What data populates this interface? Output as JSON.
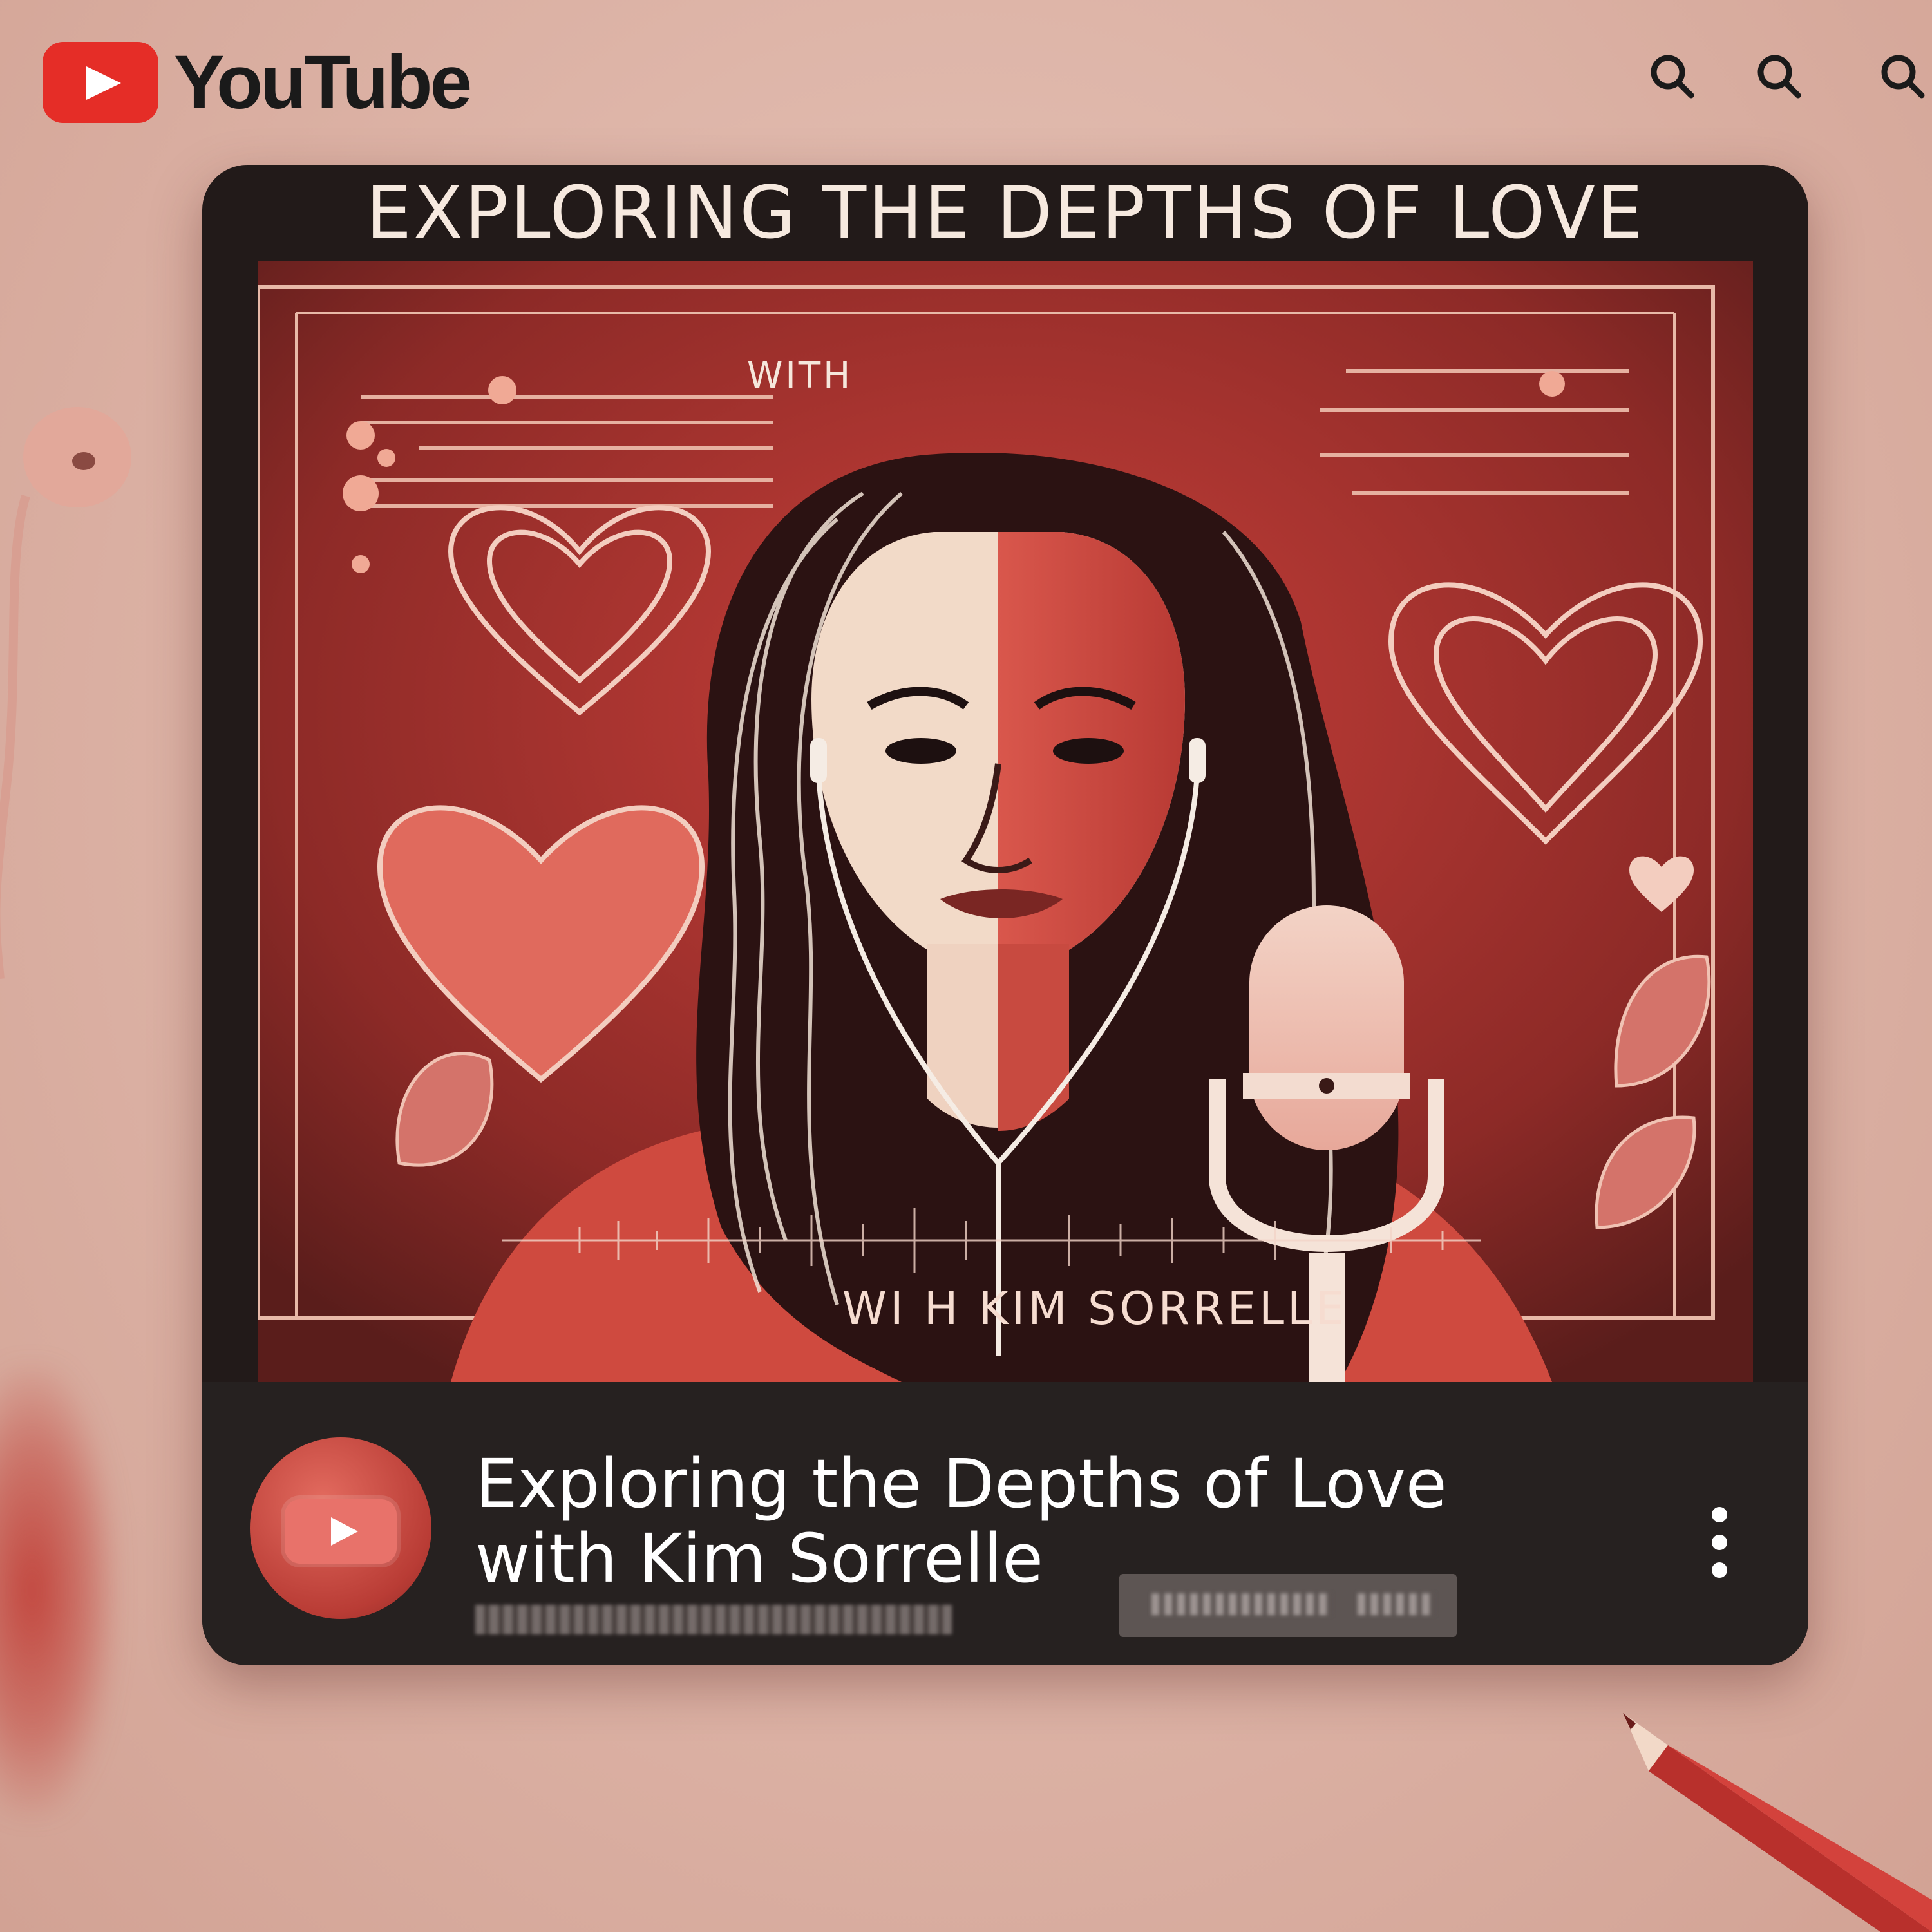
{
  "header": {
    "logo_text": "YouTube",
    "search_icons": [
      "search-icon",
      "search-icon",
      "search-icon"
    ]
  },
  "card": {
    "banner_title": "EXPLORING THE DEPTHS OF LOVE",
    "art_with_label": "WITH",
    "art_host_label": "WI H KIM SORRELLE"
  },
  "video": {
    "title_line1": "Exploring the Depths of Love",
    "title_line2": "with Kim Sorrelle",
    "menu_icon": "more-vert-icon"
  },
  "colors": {
    "brand_red": "#e52d27",
    "card_bg": "#221a19",
    "art_red": "#b3322e",
    "cream": "#f3e0d3"
  }
}
